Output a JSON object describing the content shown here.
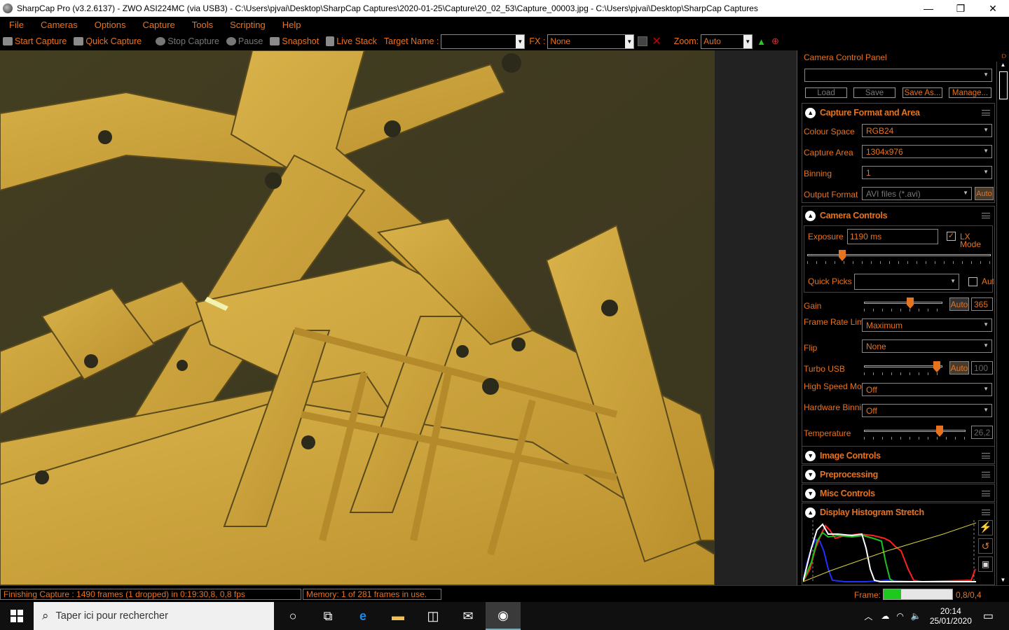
{
  "window": {
    "title": "SharpCap Pro (v3.2.6137) - ZWO ASI224MC (via USB3) - C:\\Users\\pjvai\\Desktop\\SharpCap Captures\\2020-01-25\\Capture\\20_02_53\\Capture_00003.jpg - C:\\Users\\pjvai\\Desktop\\SharpCap Captures",
    "minimize": "—",
    "maximize": "❐",
    "close": "✕"
  },
  "menu": [
    "File",
    "Cameras",
    "Options",
    "Capture",
    "Tools",
    "Scripting",
    "Help"
  ],
  "toolbar": {
    "start_capture": "Start Capture",
    "quick_capture": "Quick Capture",
    "stop_capture": "Stop Capture",
    "pause": "Pause",
    "snapshot": "Snapshot",
    "live_stack": "Live Stack",
    "target_name_label": "Target Name :",
    "target_name_value": "",
    "fx_label": "FX :",
    "fx_value": "None",
    "zoom_label": "Zoom:",
    "zoom_value": "Auto"
  },
  "panel": {
    "title": "Camera Control Panel",
    "pin": "⫐",
    "profile_value": "",
    "load": "Load",
    "save": "Save",
    "save_as": "Save As...",
    "manage": "Manage...",
    "capture_format": {
      "title": "Capture Format and Area",
      "colour_space_label": "Colour Space",
      "colour_space": "RGB24",
      "capture_area_label": "Capture Area",
      "capture_area": "1304x976",
      "binning_label": "Binning",
      "binning": "1",
      "output_format_label": "Output Format",
      "output_format": "AVI files (*.avi)",
      "auto": "Auto"
    },
    "camera_controls": {
      "title": "Camera Controls",
      "exposure_label": "Exposure",
      "exposure": "1190 ms",
      "lx_mode": "LX Mode",
      "lx_checked": true,
      "exposure_level": 0.18,
      "quick_picks_label": "Quick Picks",
      "quick_picks": "",
      "quick_auto": "Auto",
      "gain_label": "Gain",
      "gain_auto": "Auto",
      "gain": "365",
      "gain_level": 0.6,
      "frame_rate_label": "Frame Rate Limit",
      "frame_rate": "Maximum",
      "flip_label": "Flip",
      "flip": "None",
      "turbo_label": "Turbo USB",
      "turbo_auto": "Auto",
      "turbo": "100",
      "turbo_level": 0.97,
      "high_speed_label": "High Speed Mode",
      "high_speed": "Off",
      "hw_binning_label": "Hardware Binning",
      "hw_binning": "Off",
      "temperature_label": "Temperature",
      "temperature": "26,2",
      "temperature_level": 0.76
    },
    "image_controls": "Image Controls",
    "preprocessing": "Preprocessing",
    "misc_controls": "Misc Controls",
    "histogram": "Display Histogram Stretch"
  },
  "status": {
    "capture": "Finishing Capture : 1490 frames (1 dropped) in 0:19:30,8, 0,8 fps",
    "memory": "Memory: 1 of 281 frames in use.",
    "frame_label": "Frame:",
    "frame_progress": 0.25,
    "frame_value": "0,8/0,4"
  },
  "taskbar": {
    "search_placeholder": "Taper ici pour rechercher",
    "time": "20:14",
    "date": "25/01/2020"
  }
}
